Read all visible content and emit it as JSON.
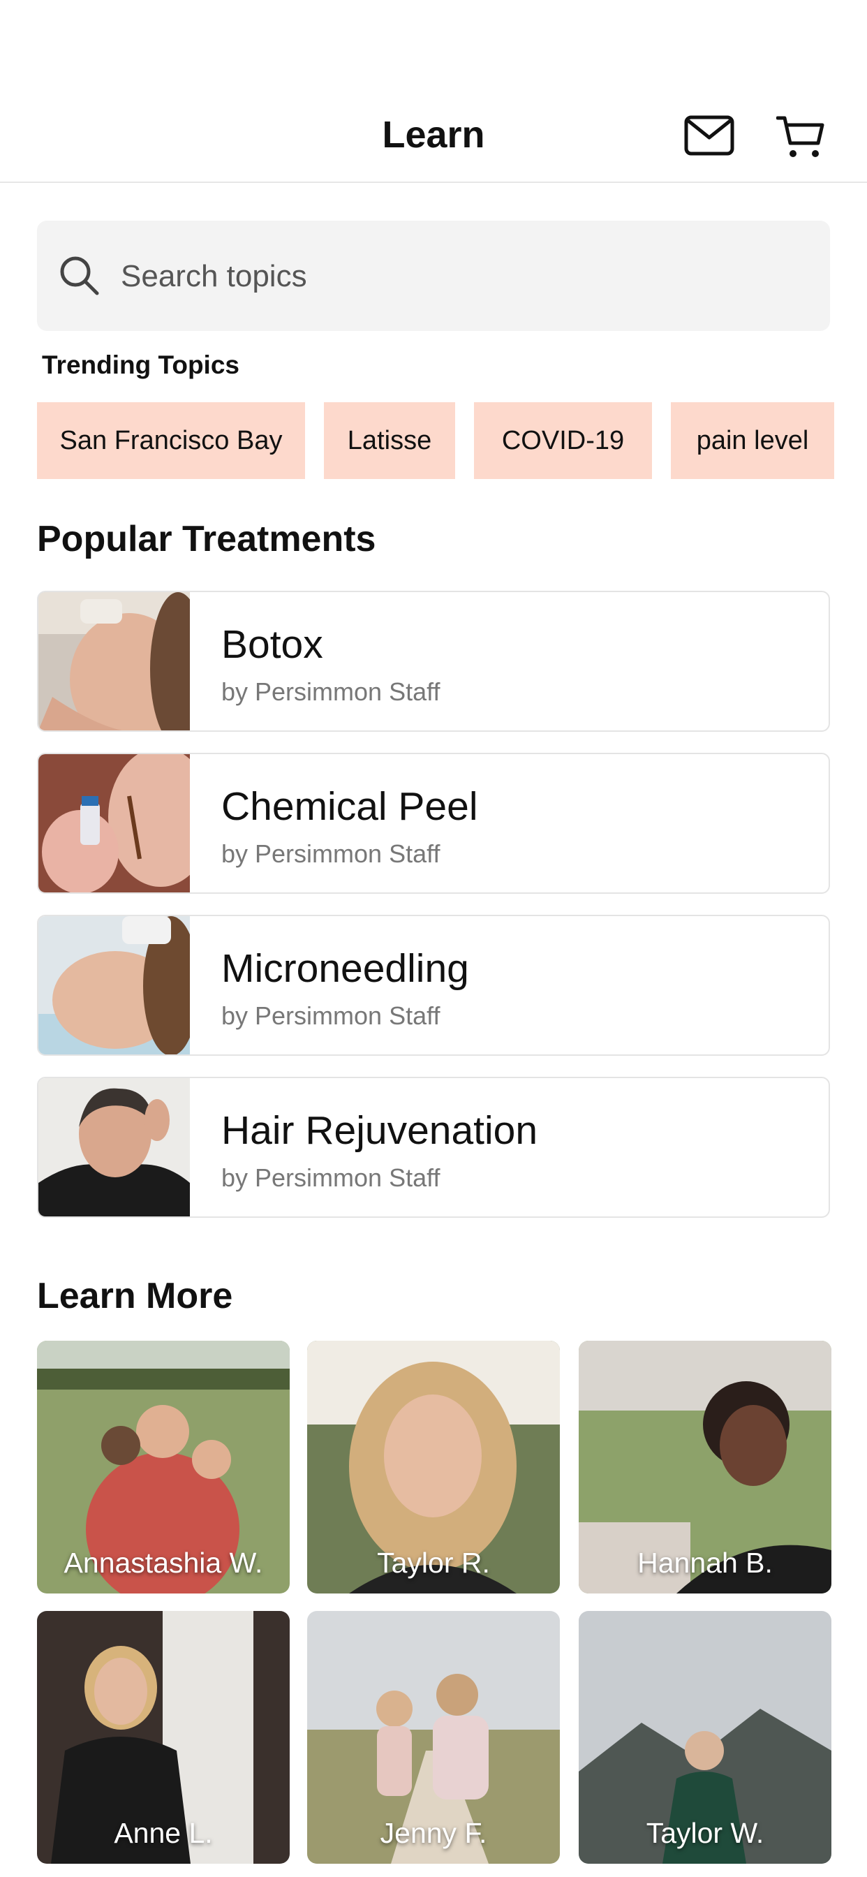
{
  "header": {
    "title": "Learn",
    "icons": [
      "mail-icon",
      "cart-icon"
    ]
  },
  "search": {
    "placeholder": "Search topics",
    "icon": "search-icon"
  },
  "trending": {
    "label": "Trending Topics",
    "chips": [
      "San Francisco Bay",
      "Latisse",
      "COVID-19",
      "pain level"
    ],
    "chip_color": "#fdd9cc"
  },
  "popular": {
    "title": "Popular Treatments",
    "items": [
      {
        "title": "Botox",
        "author": "by Persimmon Staff"
      },
      {
        "title": "Chemical Peel",
        "author": "by Persimmon Staff"
      },
      {
        "title": "Microneedling",
        "author": "by Persimmon Staff"
      },
      {
        "title": "Hair Rejuvenation",
        "author": "by Persimmon Staff"
      }
    ]
  },
  "learn_more": {
    "title": "Learn More",
    "people": [
      "Annastashia W.",
      "Taylor R.",
      "Hannah B.",
      "Anne L.",
      "Jenny F.",
      "Taylor W."
    ]
  }
}
